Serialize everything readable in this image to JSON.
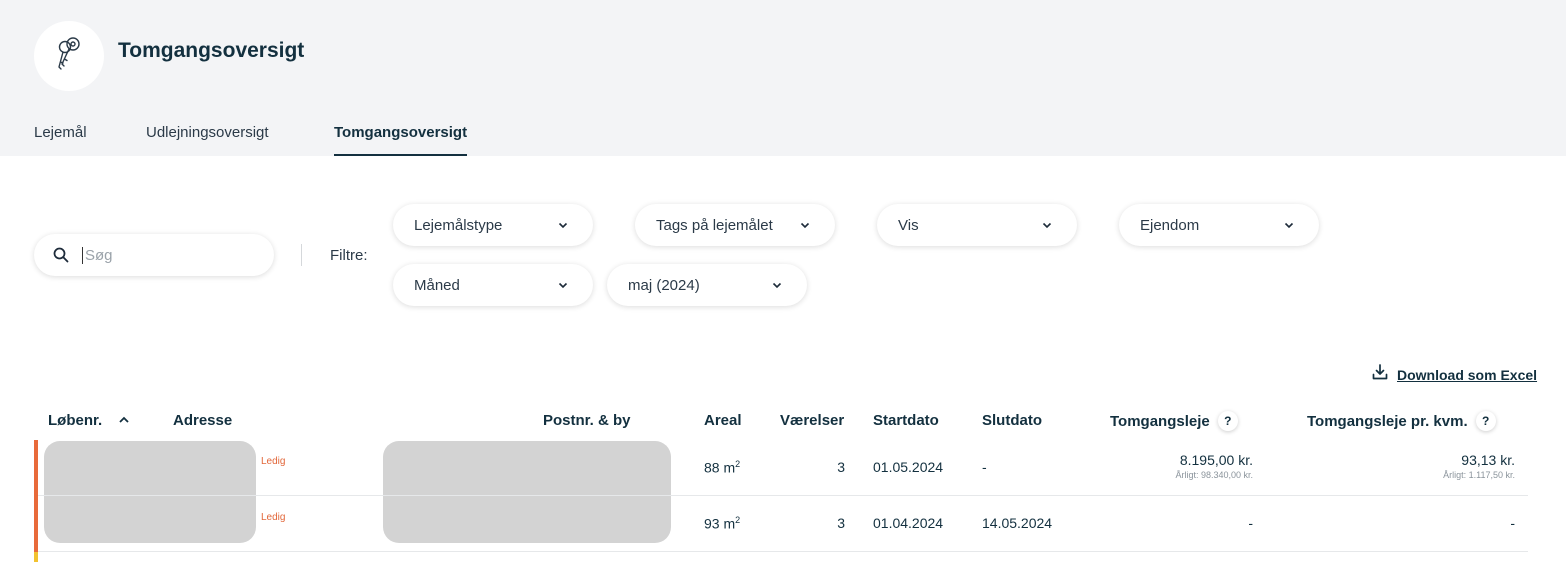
{
  "header": {
    "title": "Tomgangsoversigt",
    "logo_icon": "keys-icon"
  },
  "tabs": [
    {
      "label": "Lejemål",
      "active": false
    },
    {
      "label": "Udlejningsoversigt",
      "active": false
    },
    {
      "label": "Tomgangsoversigt",
      "active": true
    }
  ],
  "search": {
    "placeholder": "Søg",
    "value": ""
  },
  "filters": {
    "label": "Filtre:",
    "dropdowns": [
      {
        "label": "Lejemålstype"
      },
      {
        "label": "Tags på lejemålet"
      },
      {
        "label": "Vis"
      },
      {
        "label": "Ejendom"
      },
      {
        "label": "Måned"
      },
      {
        "label": "maj (2024)"
      }
    ]
  },
  "download": {
    "label": "Download som Excel",
    "icon": "download-icon"
  },
  "table": {
    "columns": {
      "lobenr": "Løbenr.",
      "adresse": "Adresse",
      "postnr": "Postnr. & by",
      "areal": "Areal",
      "vaerelser": "Værelser",
      "startdato": "Startdato",
      "slutdato": "Slutdato",
      "tomgangsleje": "Tomgangsleje",
      "tomgangsleje_kvm": "Tomgangsleje pr. kvm.",
      "help": "?"
    },
    "sort": {
      "column": "lobenr",
      "direction": "ascending"
    },
    "rows": [
      {
        "status": "Ledig",
        "areal": "88 m",
        "areal_unit_sup": "2",
        "vaerelser": "3",
        "startdato": "01.05.2024",
        "slutdato": "-",
        "tomgangsleje": "8.195,00 kr.",
        "tomgangsleje_arligt": "Årligt: 98.340,00 kr.",
        "tomgangsleje_kvm": "93,13 kr.",
        "tomgangsleje_kvm_arligt": "Årligt: 1.117,50 kr.",
        "bar_color": "#e86a3a"
      },
      {
        "status": "Ledig",
        "areal": "93 m",
        "areal_unit_sup": "2",
        "vaerelser": "3",
        "startdato": "01.04.2024",
        "slutdato": "14.05.2024",
        "tomgangsleje": "-",
        "tomgangsleje_kvm": "-",
        "bar_color": "#e86a3a"
      }
    ]
  },
  "colors": {
    "primary": "#13303f",
    "status_ledig": "#e2673a",
    "third_row_bar": "#f2c230"
  }
}
